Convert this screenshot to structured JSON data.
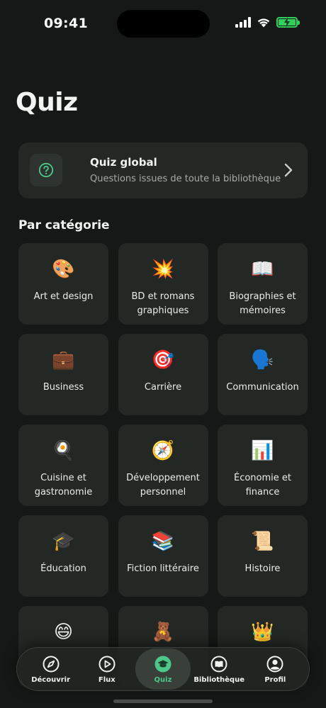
{
  "status_bar": {
    "time": "09:41"
  },
  "page": {
    "title": "Quiz"
  },
  "global_quiz": {
    "title": "Quiz global",
    "subtitle": "Questions issues de toute la bibliothèque"
  },
  "categories_section": {
    "title": "Par catégorie"
  },
  "categories": [
    {
      "emoji": "🎨",
      "label": "Art et design"
    },
    {
      "emoji": "💥",
      "label": "BD et romans graphiques"
    },
    {
      "emoji": "📖",
      "label": "Biographies et mémoires"
    },
    {
      "emoji": "💼",
      "label": "Business"
    },
    {
      "emoji": "🎯",
      "label": "Carrière"
    },
    {
      "emoji": "🗣️",
      "label": "Communication"
    },
    {
      "emoji": "🍳",
      "label": "Cuisine et gastronomie"
    },
    {
      "emoji": "🧭",
      "label": "Développement personnel"
    },
    {
      "emoji": "📊",
      "label": "Économie et finance"
    },
    {
      "emoji": "🎓",
      "label": "Éducation"
    },
    {
      "emoji": "📚",
      "label": "Fiction littéraire"
    },
    {
      "emoji": "📜",
      "label": "Histoire"
    },
    {
      "emoji": "😄",
      "label": ""
    },
    {
      "emoji": "🧸",
      "label": ""
    },
    {
      "emoji": "👑",
      "label": ""
    }
  ],
  "bottom_nav": {
    "items": [
      {
        "label": "Découvrir",
        "icon": "compass-icon"
      },
      {
        "label": "Flux",
        "icon": "play-circle-icon"
      },
      {
        "label": "Quiz",
        "icon": "graduation-cap-icon"
      },
      {
        "label": "Bibliothèque",
        "icon": "book-icon"
      },
      {
        "label": "Profil",
        "icon": "profile-icon"
      }
    ],
    "active_index": 2
  },
  "colors": {
    "background": "#151816",
    "card": "#232824",
    "accent_green": "#4cc88b",
    "battery_green": "#2fd15d"
  }
}
